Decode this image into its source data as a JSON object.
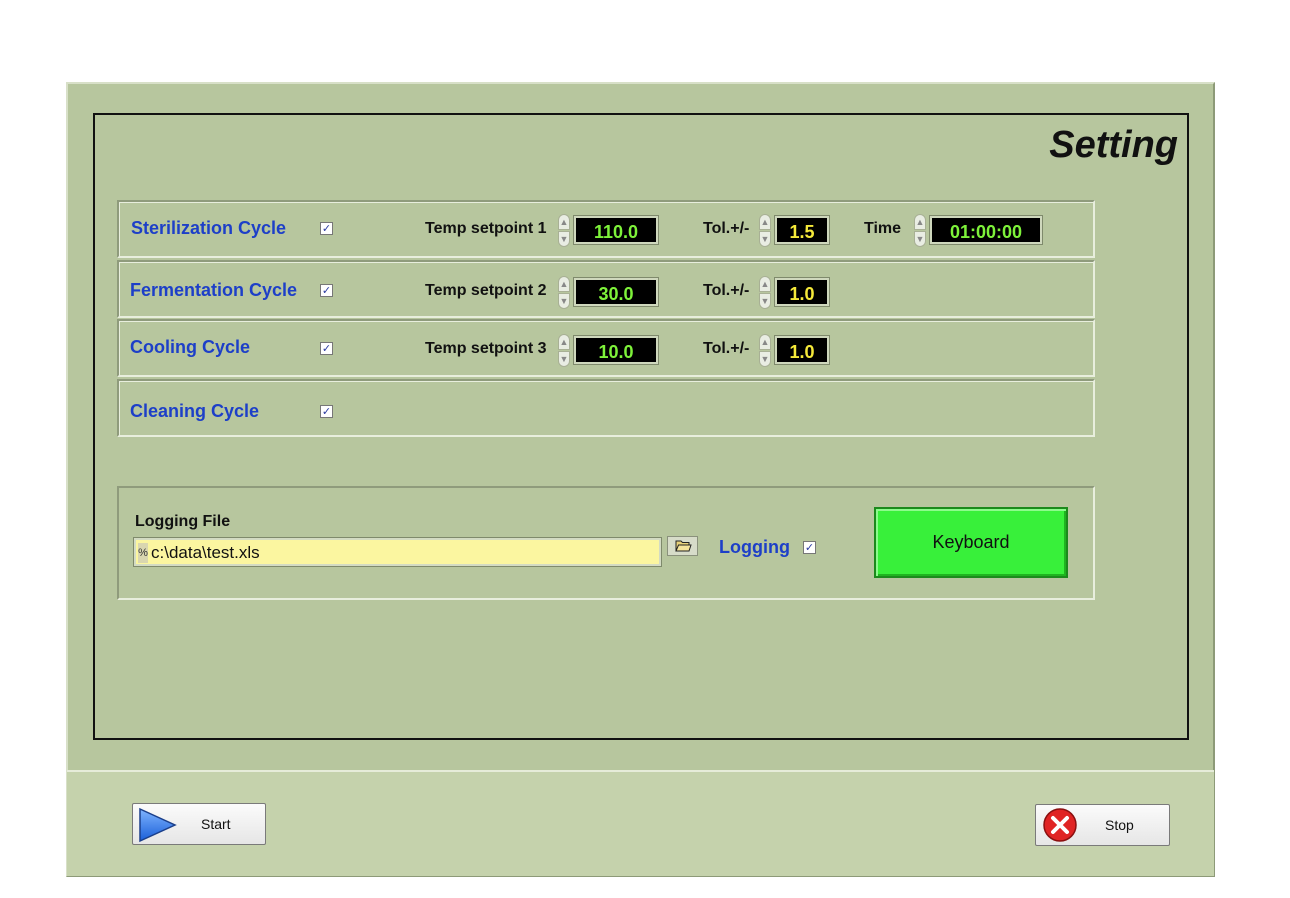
{
  "title": "Setting",
  "cycles": [
    {
      "label": "Sterilization Cycle",
      "enabled": true,
      "temp_label": "Temp setpoint 1",
      "temp": "110.0",
      "tol_label": "Tol.+/-",
      "tol": "1.5",
      "time_label": "Time",
      "time": "01:00:00"
    },
    {
      "label": "Fermentation Cycle",
      "enabled": true,
      "temp_label": "Temp setpoint 2",
      "temp": "30.0",
      "tol_label": "Tol.+/-",
      "tol": "1.0"
    },
    {
      "label": "Cooling Cycle",
      "enabled": true,
      "temp_label": "Temp setpoint 3",
      "temp": "10.0",
      "tol_label": "Tol.+/-",
      "tol": "1.0"
    },
    {
      "label": "Cleaning Cycle",
      "enabled": true
    }
  ],
  "logging": {
    "file_label": "Logging File",
    "path": "c:\\data\\test.xls",
    "logging_label": "Logging",
    "logging_enabled": true,
    "keyboard_label": "Keyboard"
  },
  "footer": {
    "start_label": "Start",
    "stop_label": "Stop"
  },
  "icons": {
    "checkbox_mark": "✓",
    "spin_up": "▲",
    "spin_down": "▼",
    "browse": "folder-open-icon",
    "start": "play-arrow-icon",
    "stop": "red-x-icon"
  },
  "colors": {
    "panel_bg": "#b7c69e",
    "cycle_label": "#1d3fc8",
    "temp_value": "#7ef23a",
    "tol_value": "#f5e93a",
    "keyboard_button": "#38f03a",
    "path_field": "#fbf6a0"
  }
}
